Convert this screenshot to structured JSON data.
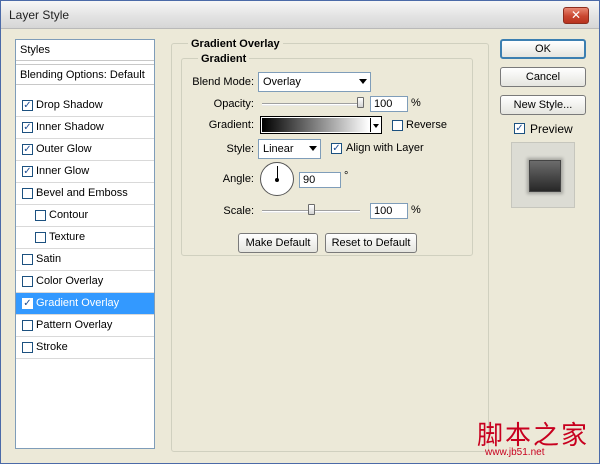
{
  "window": {
    "title": "Layer Style",
    "close_glyph": "✕"
  },
  "styles_panel": {
    "header": "Styles",
    "blending_options": "Blending Options: Default",
    "items": [
      {
        "label": "Drop Shadow",
        "checked": true,
        "indent": false,
        "selected": false
      },
      {
        "label": "Inner Shadow",
        "checked": true,
        "indent": false,
        "selected": false
      },
      {
        "label": "Outer Glow",
        "checked": true,
        "indent": false,
        "selected": false
      },
      {
        "label": "Inner Glow",
        "checked": true,
        "indent": false,
        "selected": false
      },
      {
        "label": "Bevel and Emboss",
        "checked": false,
        "indent": false,
        "selected": false
      },
      {
        "label": "Contour",
        "checked": false,
        "indent": true,
        "selected": false
      },
      {
        "label": "Texture",
        "checked": false,
        "indent": true,
        "selected": false
      },
      {
        "label": "Satin",
        "checked": false,
        "indent": false,
        "selected": false
      },
      {
        "label": "Color Overlay",
        "checked": false,
        "indent": false,
        "selected": false
      },
      {
        "label": "Gradient Overlay",
        "checked": true,
        "indent": false,
        "selected": true
      },
      {
        "label": "Pattern Overlay",
        "checked": false,
        "indent": false,
        "selected": false
      },
      {
        "label": "Stroke",
        "checked": false,
        "indent": false,
        "selected": false
      }
    ]
  },
  "gradient_overlay": {
    "section_title": "Gradient Overlay",
    "subsection_title": "Gradient",
    "blend_mode": {
      "label": "Blend Mode:",
      "value": "Overlay"
    },
    "opacity": {
      "label": "Opacity:",
      "value": "100",
      "unit": "%",
      "level": 1.0
    },
    "gradient": {
      "label": "Gradient:",
      "reverse_label": "Reverse",
      "reverse_checked": false
    },
    "style": {
      "label": "Style:",
      "value": "Linear",
      "align_label": "Align with Layer",
      "align_checked": true
    },
    "angle": {
      "label": "Angle:",
      "value": "90",
      "unit": "°"
    },
    "scale": {
      "label": "Scale:",
      "value": "100",
      "unit": "%",
      "level": 0.5
    },
    "make_default": "Make Default",
    "reset_default": "Reset to Default"
  },
  "buttons": {
    "ok": "OK",
    "cancel": "Cancel",
    "new_style": "New Style...",
    "preview_label": "Preview",
    "preview_checked": true
  },
  "watermark": {
    "main": "脚本之家",
    "url": "www.jb51.net"
  }
}
